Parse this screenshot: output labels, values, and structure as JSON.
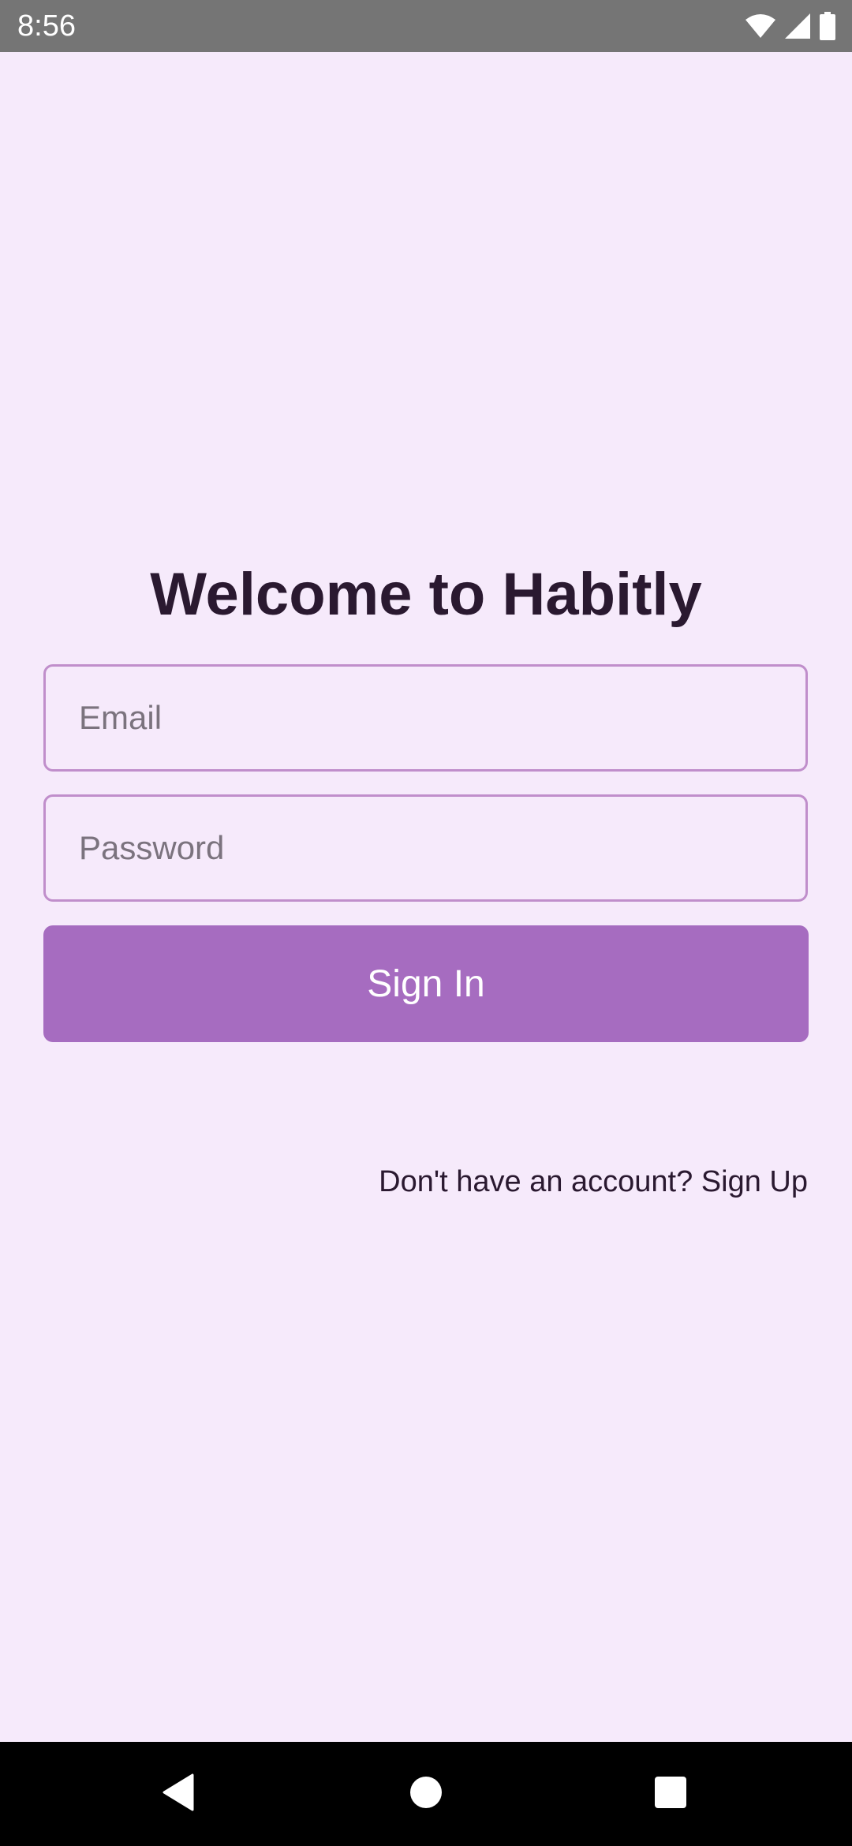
{
  "status_bar": {
    "time": "8:56",
    "icons": [
      "wifi-icon",
      "cell-signal-icon",
      "battery-icon"
    ]
  },
  "login": {
    "title": "Welcome to Habitly",
    "email": {
      "placeholder": "Email",
      "value": ""
    },
    "password": {
      "placeholder": "Password",
      "value": ""
    },
    "sign_in_label": "Sign In",
    "signup_prompt": "Don't have an account? Sign Up"
  },
  "nav_bar": {
    "icons": [
      "back-icon",
      "home-icon",
      "recents-icon"
    ]
  },
  "colors": {
    "background": "#F6EAFB",
    "accent": "#A66CC0",
    "field_border": "#C08ECB",
    "text": "#2A1930",
    "status_bar": "#757575",
    "nav_bar": "#000000"
  }
}
